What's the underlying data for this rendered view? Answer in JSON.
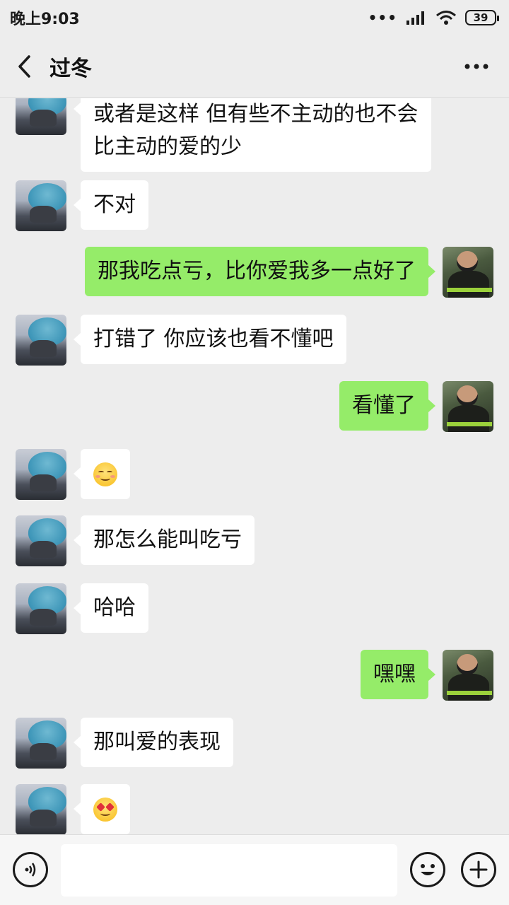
{
  "status_bar": {
    "time": "晚上9:03",
    "signal_dots": "•••",
    "battery": "39"
  },
  "header": {
    "title": "过冬",
    "back_icon": "chevron-left-icon",
    "more_icon": "more-dots-icon"
  },
  "messages": [
    {
      "side": "left",
      "text_line1": "或者是这样 但有些不主动的也不会",
      "text_line2": "比主动的爱的少"
    },
    {
      "side": "left",
      "text": "不对"
    },
    {
      "side": "right",
      "text": "那我吃点亏，比你爱我多一点好了"
    },
    {
      "side": "left",
      "text": "打错了 你应该也看不懂吧"
    },
    {
      "side": "right",
      "text": "看懂了"
    },
    {
      "side": "left",
      "emoji": "smiling-blush-emoji"
    },
    {
      "side": "left",
      "text": "那怎么能叫吃亏"
    },
    {
      "side": "left",
      "text": "哈哈"
    },
    {
      "side": "right",
      "text": "嘿嘿"
    },
    {
      "side": "left",
      "text": "那叫爱的表现"
    },
    {
      "side": "left",
      "emoji": "heart-eyes-emoji"
    }
  ],
  "input_bar": {
    "voice_icon": "voice-icon",
    "emoji_icon": "emoji-icon",
    "plus_icon": "plus-icon",
    "placeholder": ""
  }
}
